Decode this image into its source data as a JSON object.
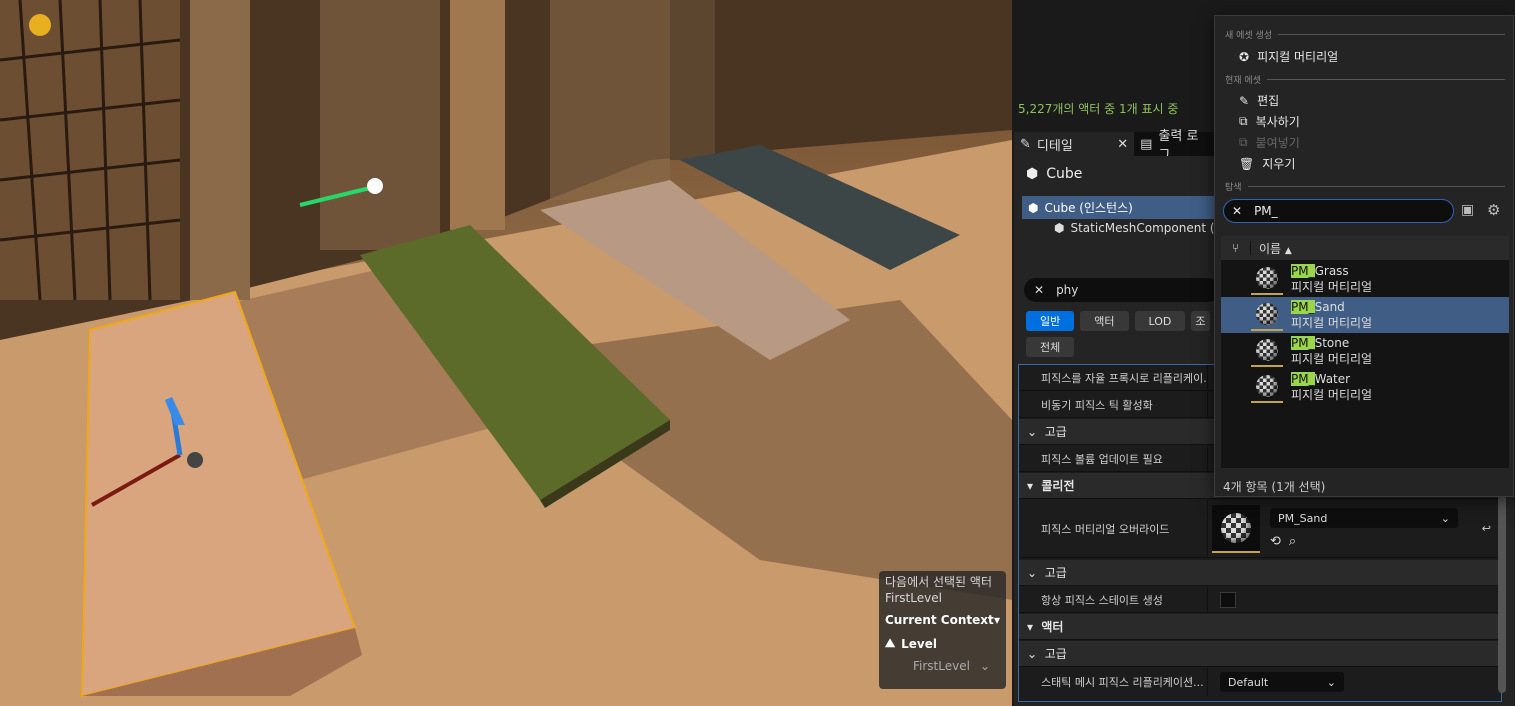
{
  "viewport": {
    "context": {
      "line1": "다음에서 선택된 액터",
      "line2": "FirstLevel",
      "current_context": "Current Context",
      "level": "Level",
      "level_value": "FirstLevel"
    }
  },
  "outliner": {
    "count_text": "5,227개의 액터 중 1개 표시 중"
  },
  "tabs": [
    {
      "label": "디테일",
      "icon": "pencil-icon"
    },
    {
      "label": "출력 로그",
      "icon": "output-log-icon"
    }
  ],
  "details": {
    "title": "Cube",
    "components": [
      {
        "label": "Cube (인스턴스)"
      },
      {
        "label": "StaticMeshComponent ("
      }
    ],
    "search_value": "phy",
    "filters": [
      "일반",
      "액터",
      "LOD",
      "전체"
    ],
    "filters_cut": "조",
    "rows": {
      "r1": "피직스를 자율 프록시로 리플리케이...",
      "r2": "비동기 피직스 틱 활성화",
      "cat_advanced1": "고급",
      "r3": "피직스 볼륨 업데이트 필요",
      "cat_collision": "콜리전",
      "phys_mat_override": "피직스 머티리얼 오버라이드",
      "phys_mat_value": "PM_Sand",
      "cat_advanced2": "고급",
      "r_always_state": "항상 피직스 스테이트 생성",
      "cat_actor": "액터",
      "cat_advanced3": "고급",
      "r_static_mesh": "스태틱 메시 피직스 리플리케이션...",
      "static_mesh_value": "Default"
    }
  },
  "dropdown": {
    "sec_new": "새 에셋 생성",
    "create_label": "피지컬 머티리얼",
    "sec_current": "현재 에셋",
    "edit": "편집",
    "copy": "복사하기",
    "paste": "붙여넣기",
    "delete": "지우기",
    "sec_browse": "탐색",
    "search_value": "PM_",
    "column_name": "이름",
    "sort_arrow": "▲",
    "items": [
      {
        "prefix": "PM_",
        "rest": "Grass",
        "type": "피지컬 머티리얼"
      },
      {
        "prefix": "PM_",
        "rest": "Sand",
        "type": "피지컬 머티리얼"
      },
      {
        "prefix": "PM_",
        "rest": "Stone",
        "type": "피지컬 머티리얼"
      },
      {
        "prefix": "PM_",
        "rest": "Water",
        "type": "피지컬 머티리얼"
      }
    ],
    "footer": "4개 항목 (1개 선택)"
  }
}
